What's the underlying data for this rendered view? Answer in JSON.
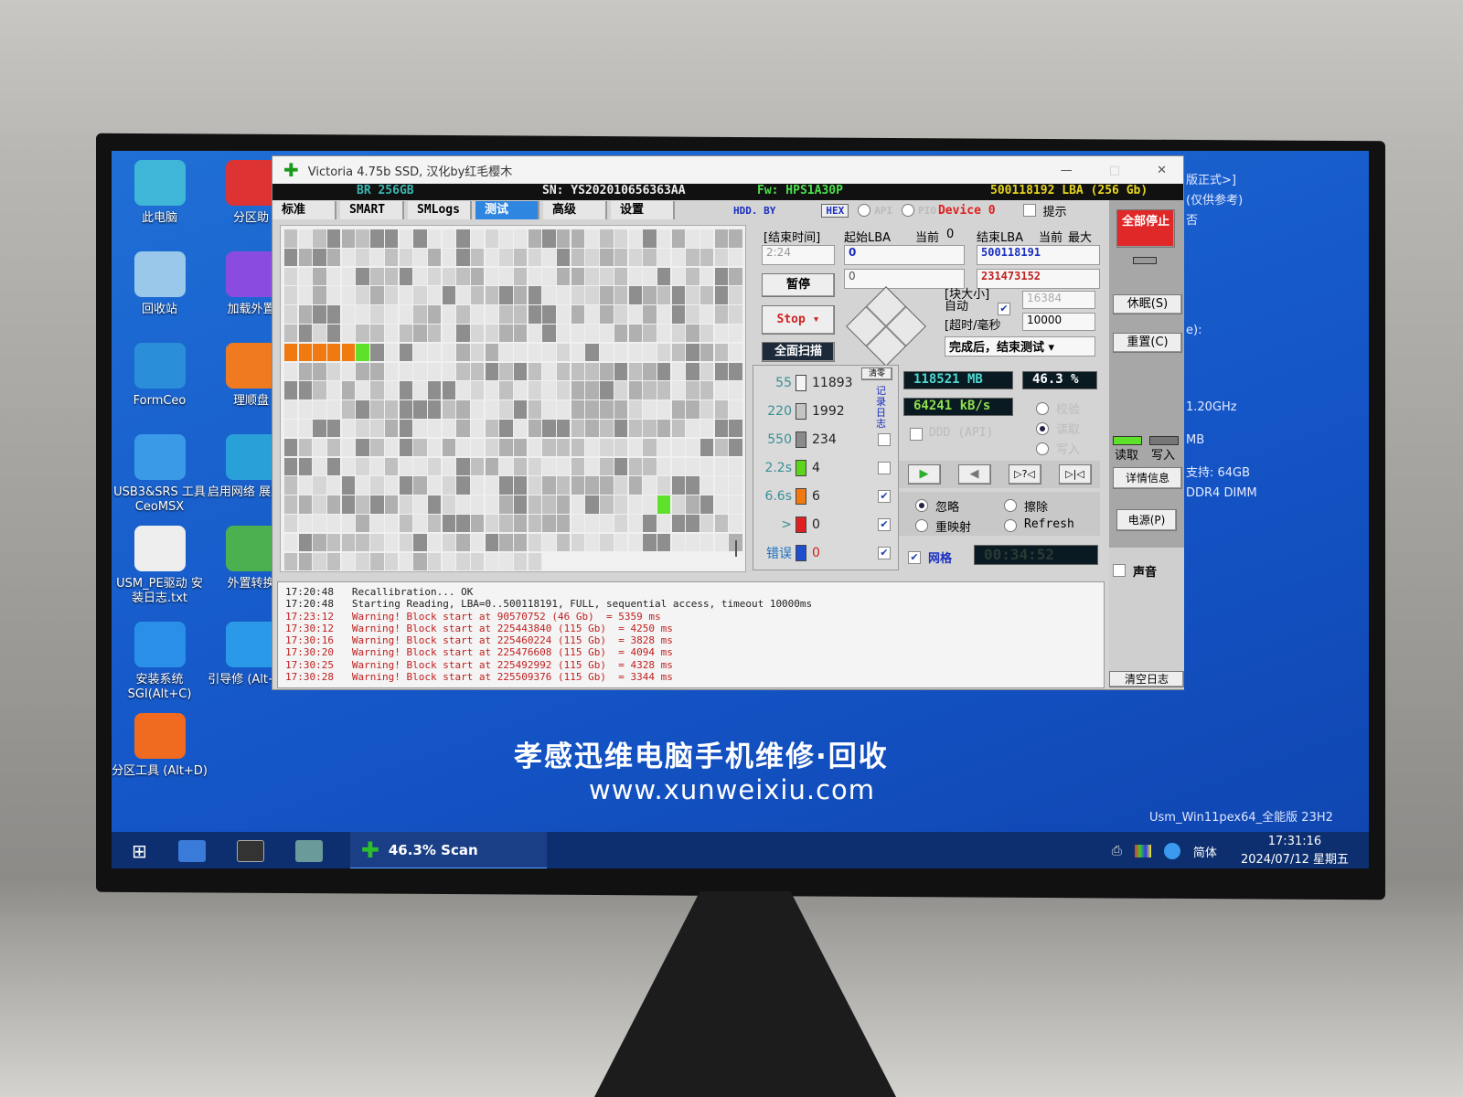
{
  "window": {
    "title": "Victoria 4.75b SSD, 汉化by红毛樱木",
    "minimize": "—",
    "maximize": "□",
    "close": "✕"
  },
  "info": {
    "model": "BR 256GB",
    "serial": "SN:  YS202010656363AA",
    "firmware": "Fw:  HPS1A30P",
    "capacity": "500118192 LBA (256 Gb)"
  },
  "tabs": [
    {
      "label": "标准"
    },
    {
      "label": "SMART"
    },
    {
      "label": "SMLogs"
    },
    {
      "label": "测试",
      "active": true
    },
    {
      "label": "高级"
    },
    {
      "label": "设置"
    }
  ],
  "toolbar": {
    "hdd": "HDD. BY",
    "hex": "HEX",
    "api": "API",
    "pio": "PIO",
    "device": "Device 0",
    "hint": "提示"
  },
  "test": {
    "end_time_label": "[结束时间]",
    "end_time": "2:24",
    "start_lba_label": "起始LBA",
    "current_label": "当前",
    "current_value": "0",
    "start_lba": "0",
    "start_lba2": "0",
    "end_lba_label": "结束LBA",
    "end_current_label": "当前",
    "end_max_label": "最大",
    "end_lba": "500118191",
    "end_lba2": "231473152",
    "pause": "暂停",
    "stop": "Stop ▾",
    "full_scan": "全面扫描",
    "block_size_label": "[块大小]",
    "auto_label": "自动",
    "block_size": "16384",
    "timeout_label": "[超时/毫秒",
    "timeout": "10000",
    "after_done": "完成后，结束测试 ▾"
  },
  "legend": [
    {
      "time": "55",
      "count": "11893",
      "color": "#f4f4f4",
      "checked": false
    },
    {
      "time": "220",
      "count": "1992",
      "color": "#c4c4c4",
      "checked": false
    },
    {
      "time": "550",
      "count": "234",
      "color": "#8a8a8a",
      "checked": false
    },
    {
      "time": "2.2s",
      "count": "4",
      "color": "#5fd41c",
      "checked": false
    },
    {
      "time": "6.6s",
      "count": "6",
      "color": "#f07a10",
      "checked": true
    },
    {
      "time": ">",
      "count": "0",
      "color": "#e02020",
      "checked": true
    },
    {
      "time": "错误",
      "count": "0",
      "color": "#1e4fd0",
      "checked": true
    }
  ],
  "legend_side_label": "记录日志",
  "legend_clear": "清零",
  "stats": {
    "processed": "118521  MB",
    "percent": "46.3 %",
    "speed": "64241  kB/s",
    "ddd": "DDD (API)",
    "verify": "校验",
    "read": "读取",
    "write": "写入"
  },
  "modes": {
    "ignore": "忽略",
    "erase": "擦除",
    "remap": "重映射",
    "refresh": "Refresh",
    "selected": "ignore"
  },
  "grid_label": "网格",
  "elapsed": "00:34:52",
  "side": {
    "stop_all": "全部停止",
    "sleep": "休眠(S)",
    "reset": "重置(C)",
    "read": "读取",
    "write": "写入",
    "details": "详情信息",
    "power": "电源(P)",
    "sound": "声音",
    "clear_log": "清空日志"
  },
  "log": [
    {
      "time": "17:20:48",
      "text": "Recallibration... OK",
      "level": "info"
    },
    {
      "time": "17:20:48",
      "text": "Starting Reading, LBA=0..500118191, FULL, sequential access, timeout 10000ms",
      "level": "info"
    },
    {
      "time": "17:23:12",
      "text": "Warning! Block start at 90570752 (46 Gb)  = 5359 ms",
      "level": "warn"
    },
    {
      "time": "17:30:12",
      "text": "Warning! Block start at 225443840 (115 Gb)  = 4250 ms",
      "level": "warn"
    },
    {
      "time": "17:30:16",
      "text": "Warning! Block start at 225460224 (115 Gb)  = 3828 ms",
      "level": "warn"
    },
    {
      "time": "17:30:20",
      "text": "Warning! Block start at 225476608 (115 Gb)  = 4094 ms",
      "level": "warn"
    },
    {
      "time": "17:30:25",
      "text": "Warning! Block start at 225492992 (115 Gb)  = 4328 ms",
      "level": "warn"
    },
    {
      "time": "17:30:28",
      "text": "Warning! Block start at 225509376 (115 Gb)  = 3344 ms",
      "level": "warn"
    }
  ],
  "desktop": {
    "icons": [
      {
        "label": "此电脑",
        "color": "#3fb6d8"
      },
      {
        "label": "分区助",
        "color": "#d33"
      },
      {
        "label": "回收站",
        "color": "#9ac8ea"
      },
      {
        "label": "加载外置",
        "color": "#8a4be0"
      },
      {
        "label": "FormCeo",
        "color": "#2a8fd8"
      },
      {
        "label": "理顺盘",
        "color": "#f07a20"
      },
      {
        "label": "USB3&SRS 工具CeoMSX",
        "color": "#3a9ae8"
      },
      {
        "label": "启用网络 展支持",
        "color": "#2aa0d8"
      },
      {
        "label": "USM_PE驱动 安装日志.txt",
        "color": "#eee"
      },
      {
        "label": "外置转换",
        "color": "#4caf50"
      },
      {
        "label": "安装系统 SGI(Alt+C)",
        "color": "#2a8fe8"
      },
      {
        "label": "引导修 (Alt+W)",
        "color": "#2a9ae8"
      },
      {
        "label": "分区工具 (Alt+D)",
        "color": "#f06a20"
      }
    ],
    "sysinfo": [
      "版正式>]",
      "(仅供参考)",
      "否",
      "e):",
      "1.20GHz",
      "MB",
      "支持: 64GB",
      "DDR4 DIMM"
    ],
    "banner": "孝感迅维电脑手机维修·回收",
    "url": "www.xunweixiu.com",
    "version": "Usm_Win11pex64_全能版 23H2"
  },
  "taskbar": {
    "task_label": "46.3%  Scan",
    "ime": "简体",
    "time": "17:31:16",
    "date": "2024/07/12 星期五"
  }
}
